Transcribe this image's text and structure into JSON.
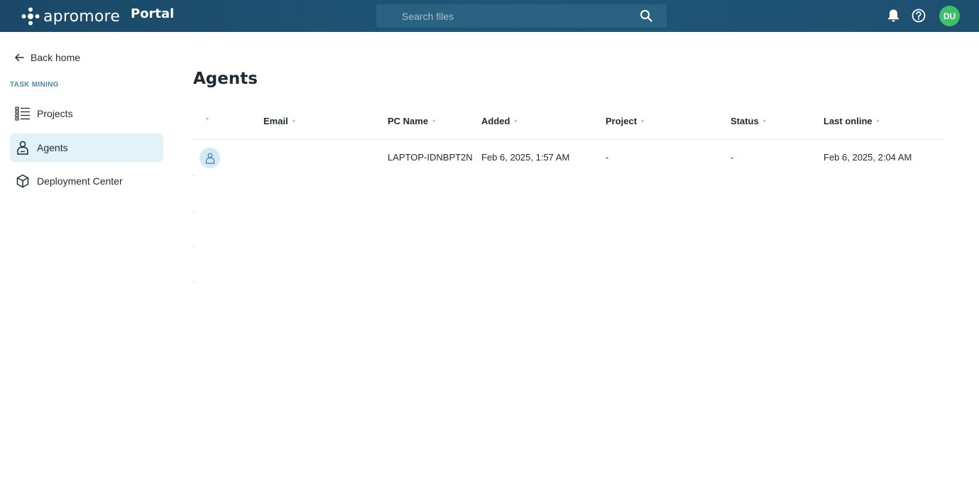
{
  "header": {
    "brand": "apromore",
    "product": "Portal",
    "search_placeholder": "Search files",
    "icons": [
      "search-icon",
      "bell-icon",
      "help-icon"
    ],
    "avatar_initials": "DU",
    "colors": {
      "bar": "#1f5677",
      "avatar": "#3fbf6a"
    }
  },
  "sidebar": {
    "back_label": "Back home",
    "section_label": "TASK MINING",
    "items": [
      {
        "label": "Projects",
        "icon": "list-icon",
        "active": false
      },
      {
        "label": "Agents",
        "icon": "person-icon",
        "active": true
      },
      {
        "label": "Deployment Center",
        "icon": "cube-icon",
        "active": false
      }
    ]
  },
  "main": {
    "title": "Agents",
    "columns": [
      "",
      "Email",
      "PC Name",
      "Added",
      "Project",
      "Status",
      "Last online"
    ],
    "rows": [
      {
        "email": "",
        "pc_name": "LAPTOP-IDNBPT2N",
        "added": "Feb 6, 2025, 1:57 AM",
        "project": "-",
        "status": "-",
        "last_online": "Feb 6, 2025, 2:04 AM"
      }
    ]
  }
}
